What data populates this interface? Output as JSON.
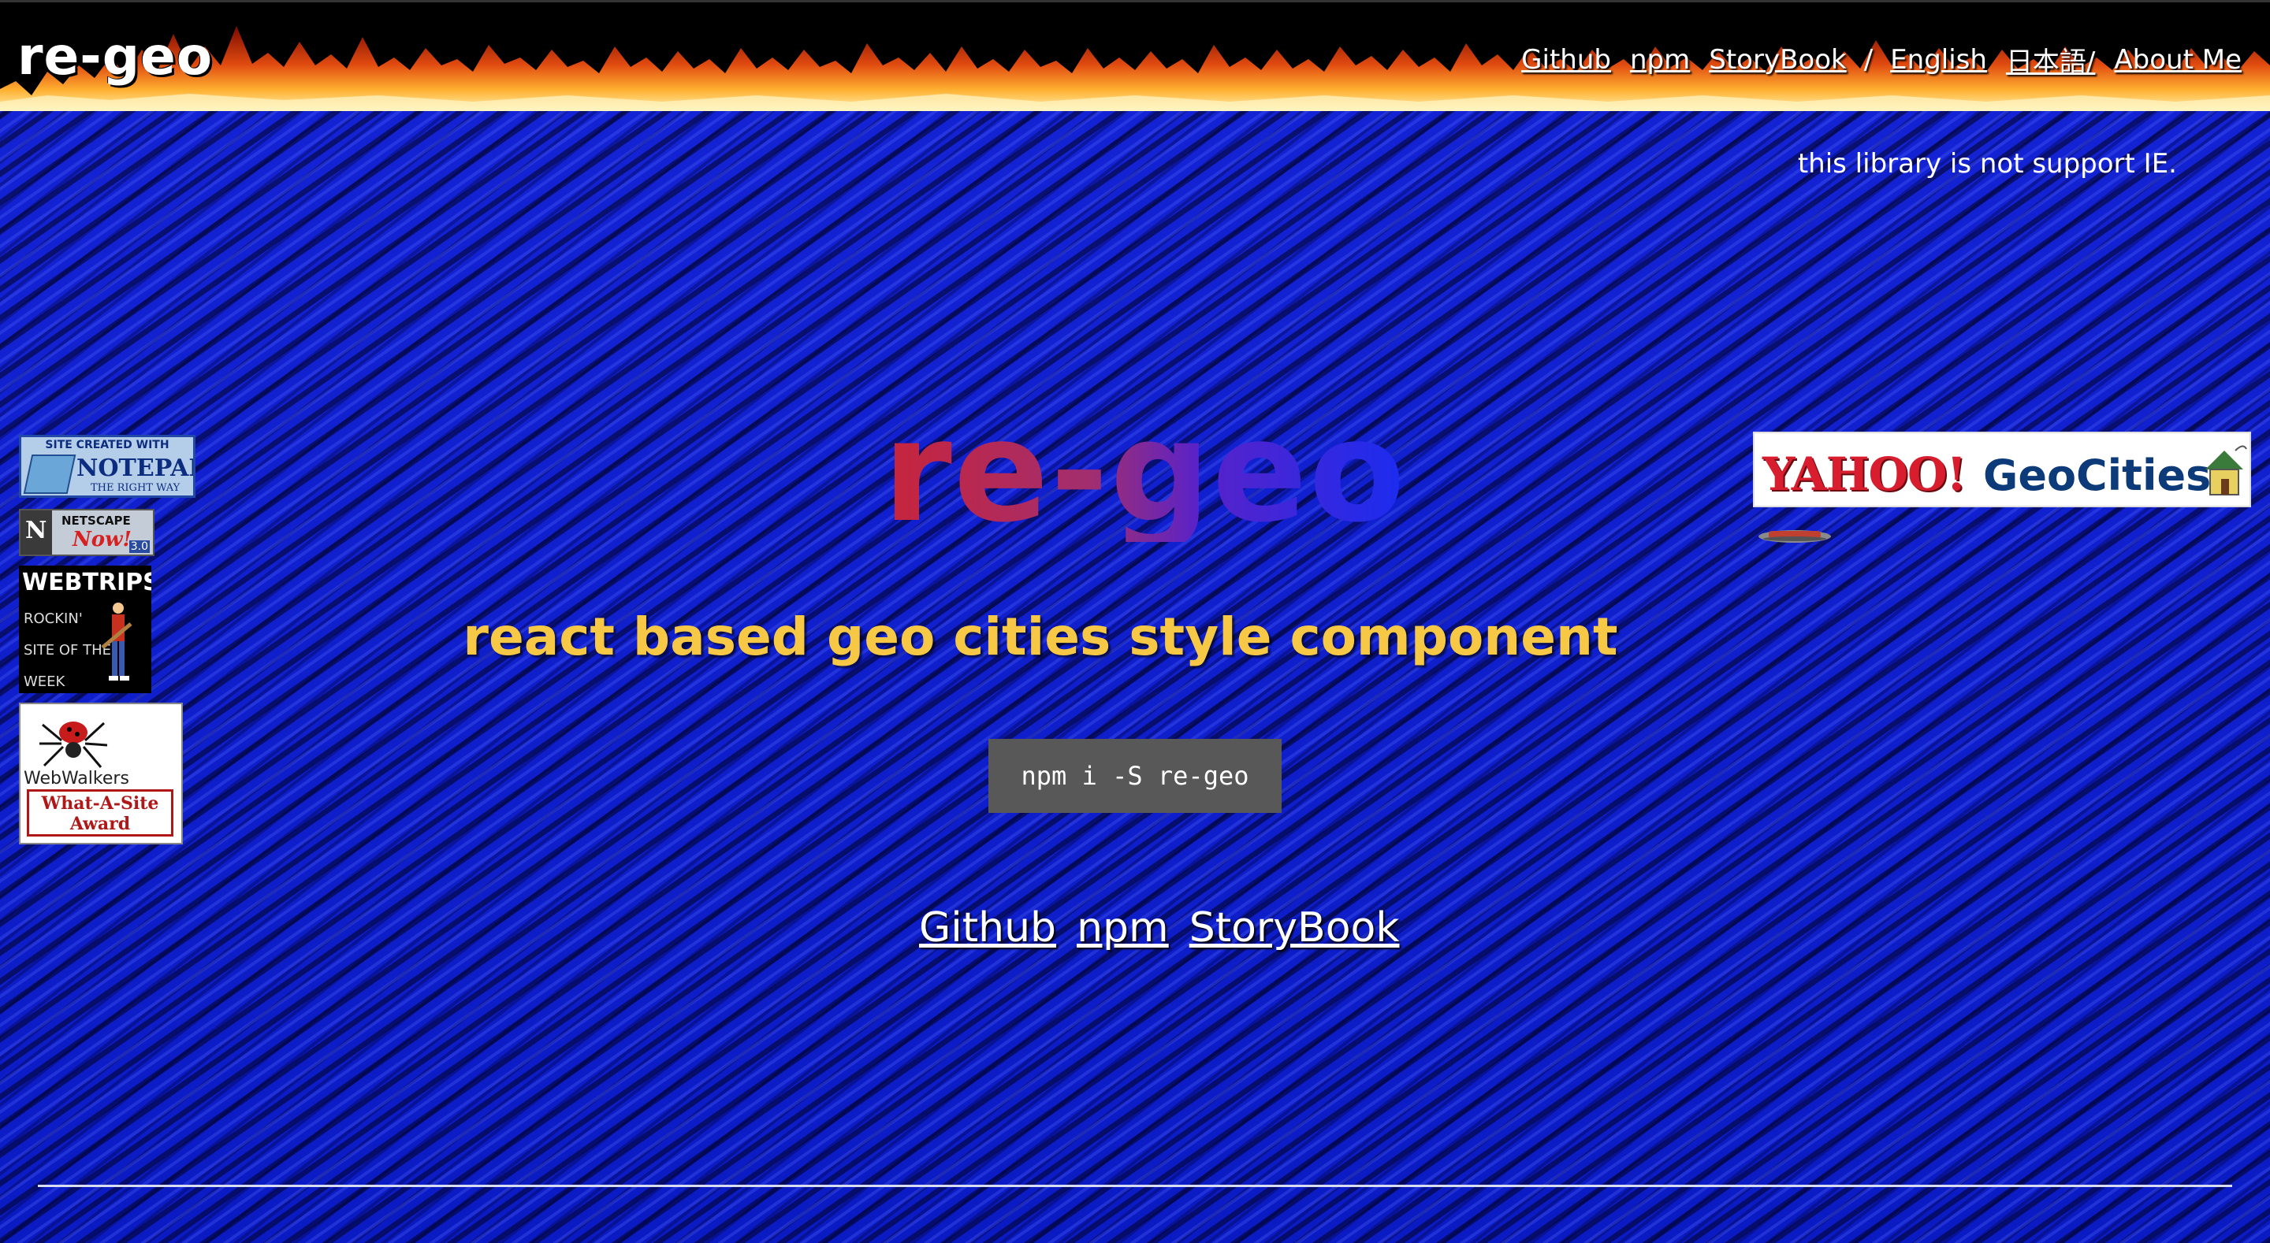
{
  "header": {
    "logo": "re-geo",
    "nav": {
      "github": "Github",
      "npm": "npm",
      "storybook": "StoryBook",
      "separator": "/",
      "english": "English",
      "japanese": "日本語/",
      "about": "About Me"
    }
  },
  "notice": "this library is not support IE.",
  "hero": {
    "title": "re-geo",
    "subtitle": "react based geo cities style component",
    "install": "npm i -S re-geo"
  },
  "links": {
    "github": "Github",
    "npm": "npm",
    "storybook": "StoryBook"
  },
  "badges": {
    "notepad": {
      "line1": "SITE CREATED WITH",
      "line2": "NOTEPAD",
      "line3": "THE RIGHT WAY"
    },
    "netscape": {
      "line1": "NETSCAPE",
      "line2": "Now!",
      "line3": "3.0"
    },
    "webtrips": {
      "line1": "WEBTRIPS",
      "line2": "ROCKIN'",
      "line3": "SITE OF THE",
      "line4": "WEEK"
    },
    "webwalkers": {
      "line1": "WebWalkers",
      "line2": "What-A-Site",
      "line3": "Award"
    },
    "yahoo": {
      "part1": "YAHOO!",
      "part2": "GeoCities"
    }
  },
  "colors": {
    "background": "#0b1cc8",
    "subtitle": "#f6c845",
    "install_bg": "#585858",
    "title_gradient_start": "#c8243a",
    "title_gradient_end": "#1a2cf0"
  },
  "icons": [
    "fire-banner",
    "notepad-icon",
    "netscape-logo-icon",
    "guitarist-icon",
    "spider-icon",
    "house-icon"
  ]
}
